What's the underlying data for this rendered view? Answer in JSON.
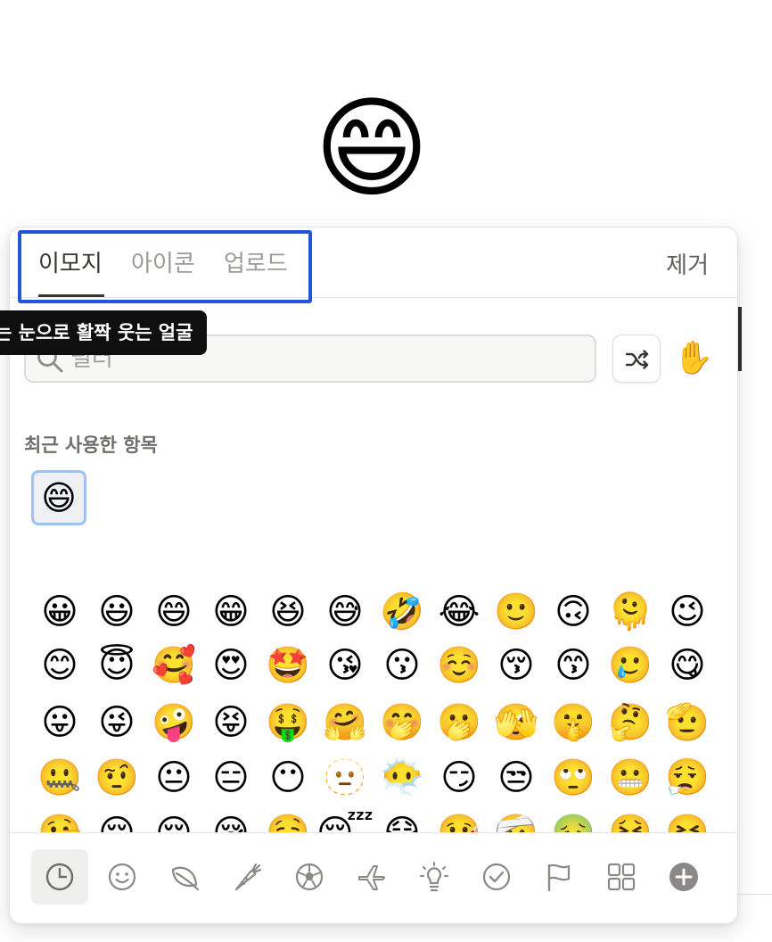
{
  "selected_emoji": "😄",
  "tabs": [
    {
      "label": "이모지"
    },
    {
      "label": "아이콘"
    },
    {
      "label": "업로드"
    }
  ],
  "remove_label": "제거",
  "search": {
    "placeholder": "필터",
    "value": ""
  },
  "skin_tone_emoji": "✋",
  "recent": {
    "label": "최근 사용한 항목",
    "items": [
      "😄"
    ]
  },
  "tooltip": "는 눈으로 활짝 웃는 얼굴",
  "emoji_grid": [
    [
      "😀",
      "😃",
      "😄",
      "😁",
      "😆",
      "😅",
      "🤣",
      "😂",
      "🙂",
      "🙃",
      "🫠",
      "😉"
    ],
    [
      "😊",
      "😇",
      "🥰",
      "😍",
      "🤩",
      "😘",
      "😗",
      "☺️",
      "😚",
      "😙",
      "🥲",
      "😋"
    ],
    [
      "😛",
      "😜",
      "🤪",
      "😝",
      "🤑",
      "🤗",
      "🤭",
      "🫢",
      "🫣",
      "🤫",
      "🤔",
      "🫡"
    ],
    [
      "🤐",
      "🤨",
      "😐",
      "😑",
      "😶",
      "🫥",
      "😶‍🌫️",
      "😏",
      "😒",
      "🙄",
      "😬",
      "😮‍💨"
    ],
    [
      "🤥",
      "😌",
      "😔",
      "😪",
      "🤤",
      "😴",
      "😷",
      "🤒",
      "🤕",
      "🤢",
      "🤮",
      "🤧"
    ]
  ],
  "categories": [
    {
      "icon": "clock-icon"
    },
    {
      "icon": "smiley-icon"
    },
    {
      "icon": "leaf-icon"
    },
    {
      "icon": "carrot-icon"
    },
    {
      "icon": "soccer-ball-icon"
    },
    {
      "icon": "airplane-icon"
    },
    {
      "icon": "lightbulb-icon"
    },
    {
      "icon": "check-circle-icon"
    },
    {
      "icon": "flag-icon"
    },
    {
      "icon": "grid-icon"
    },
    {
      "icon": "plus-circle-icon"
    }
  ],
  "colors": {
    "highlight": "#2256d6",
    "text": "#37352f",
    "muted": "#9b9a97"
  }
}
